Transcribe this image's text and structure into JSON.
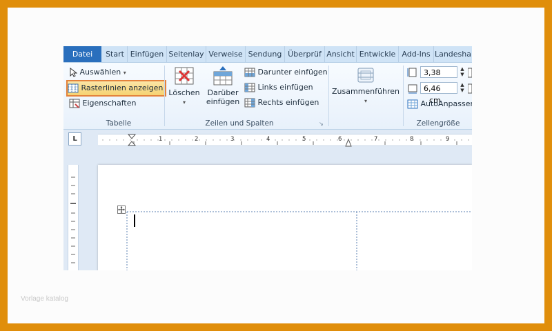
{
  "tabs": [
    {
      "label": "Datei",
      "active": true
    },
    {
      "label": "Start"
    },
    {
      "label": "Einfügen"
    },
    {
      "label": "Seitenlay"
    },
    {
      "label": "Verweise"
    },
    {
      "label": "Sendung"
    },
    {
      "label": "Überprüf"
    },
    {
      "label": "Ansicht"
    },
    {
      "label": "Entwickle"
    },
    {
      "label": "Add-Ins"
    },
    {
      "label": "Landesha"
    }
  ],
  "groups": {
    "tabelle": {
      "label": "Tabelle",
      "select": "Auswählen",
      "gridlines": "Rasterlinien anzeigen",
      "properties": "Eigenschaften"
    },
    "zeilen": {
      "label": "Zeilen und Spalten",
      "delete": "Löschen",
      "insert_above_1": "Darüber",
      "insert_above_2": "einfügen",
      "insert_below": "Darunter einfügen",
      "insert_left": "Links einfügen",
      "insert_right": "Rechts einfügen"
    },
    "merge": {
      "label": "Zusammenführen"
    },
    "zellen": {
      "label": "Zellengröße",
      "height": "3,38",
      "width": "6,46",
      "unit": "cm",
      "autofit": "AutoAnpassen"
    }
  },
  "ruler": {
    "tab_selector": "L",
    "numbers": [
      "1",
      "2",
      "3",
      "4",
      "5",
      "6",
      "7",
      "8",
      "9"
    ]
  },
  "watermark": "Vorlage katalog",
  "colors": {
    "frame": "#e08e0b",
    "file_tab": "#2a6fbd",
    "highlight": "#f6d372",
    "highlight_border": "#e4823b"
  }
}
